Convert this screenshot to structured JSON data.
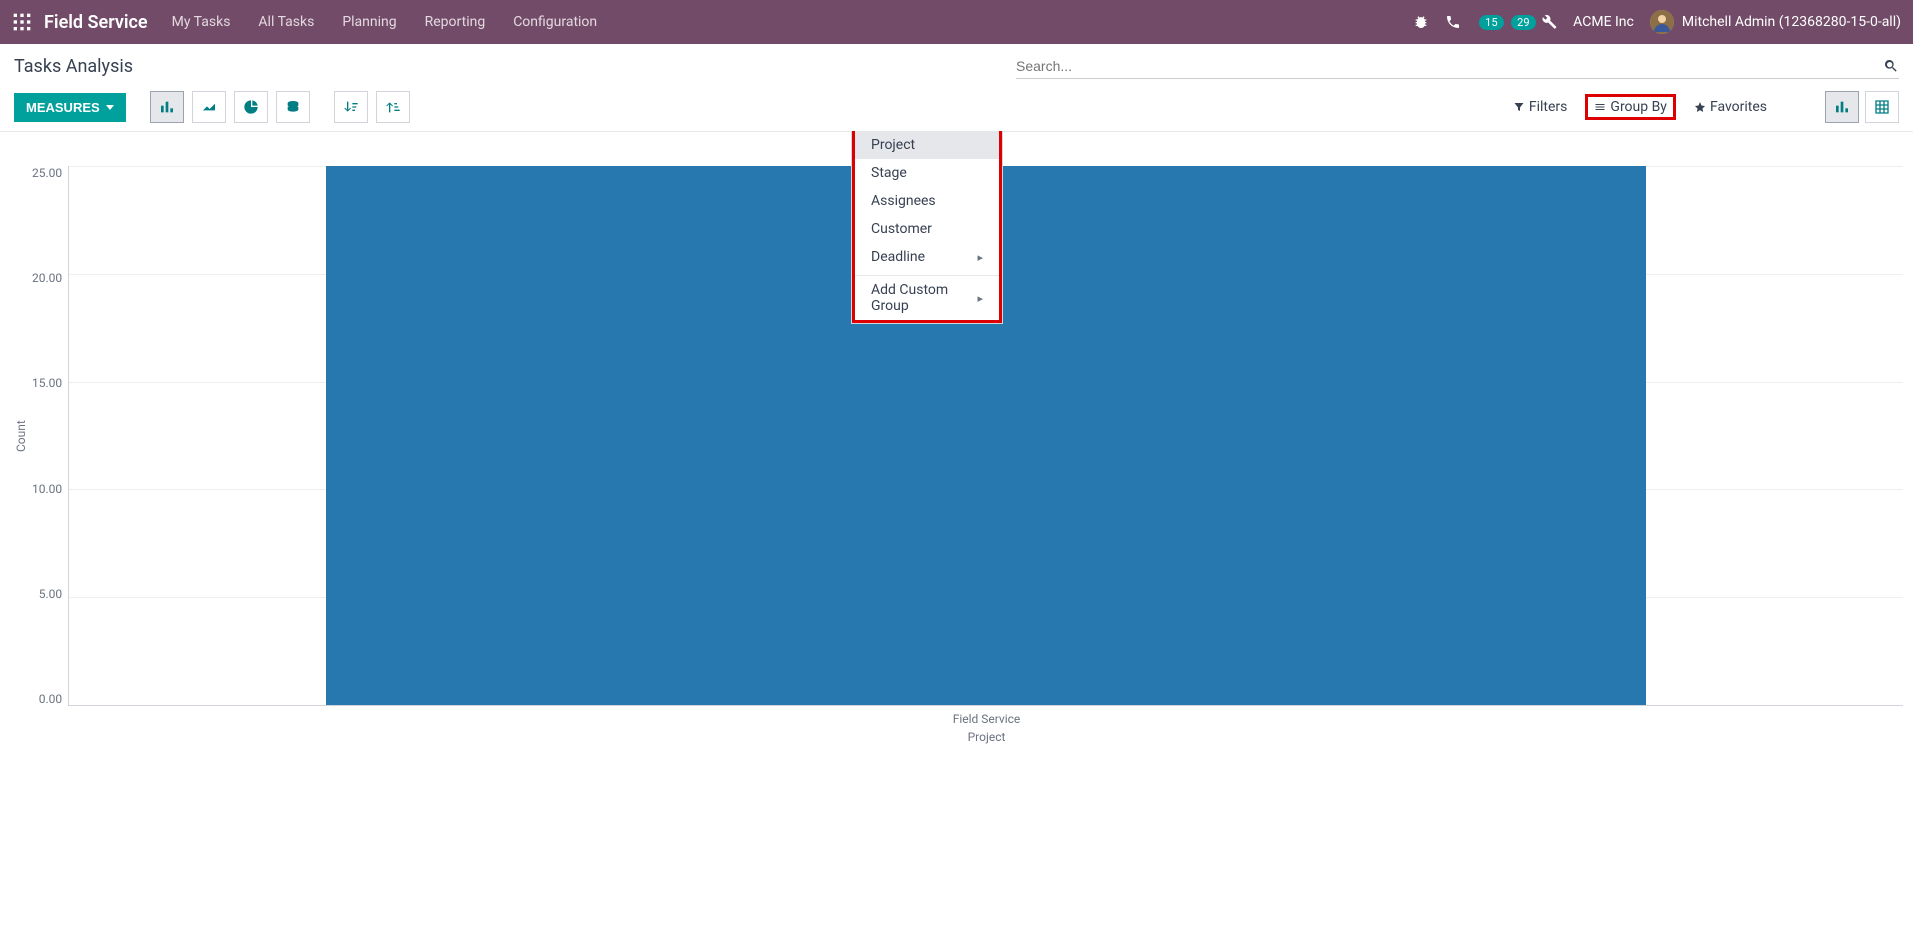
{
  "navbar": {
    "brand": "Field Service",
    "menu": [
      "My Tasks",
      "All Tasks",
      "Planning",
      "Reporting",
      "Configuration"
    ],
    "messages_badge": "15",
    "activities_badge": "29",
    "company": "ACME Inc",
    "username": "Mitchell Admin (12368280-15-0-all)"
  },
  "page": {
    "title": "Tasks Analysis",
    "search_placeholder": "Search..."
  },
  "toolbar": {
    "measures": "MEASURES",
    "filters": "Filters",
    "groupby": "Group By",
    "favorites": "Favorites"
  },
  "dropdown": {
    "items": [
      "Project",
      "Stage",
      "Assignees",
      "Customer",
      "Deadline"
    ],
    "add_custom": "Add Custom Group"
  },
  "chart_data": {
    "type": "bar",
    "categories": [
      "Field Service"
    ],
    "values": [
      25
    ],
    "legend": "Count",
    "ylabel": "Count",
    "xlabel": "Project",
    "yticks": [
      "25.00",
      "20.00",
      "15.00",
      "10.00",
      "5.00",
      "0.00"
    ],
    "ylim": [
      0,
      25
    ],
    "xtick": "Field Service",
    "xsublabel": "Project"
  }
}
